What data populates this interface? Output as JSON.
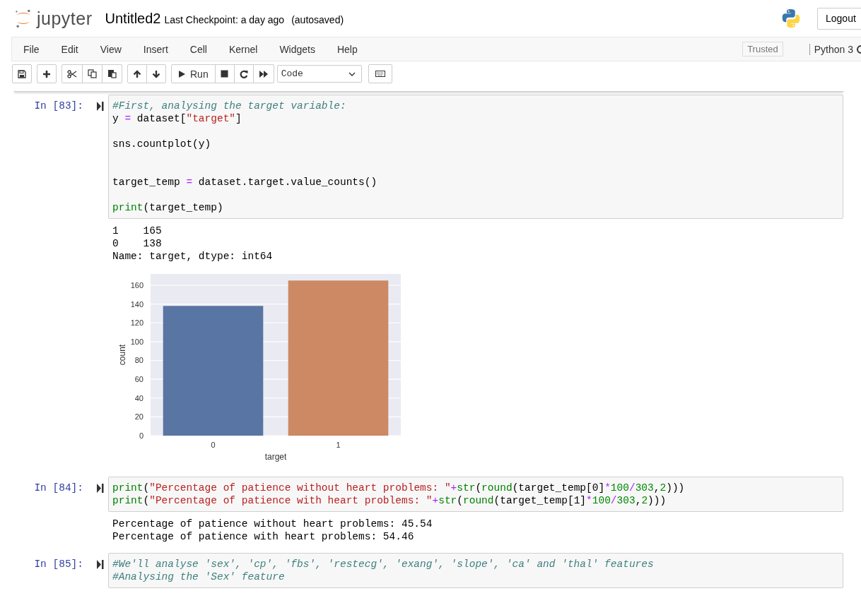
{
  "header": {
    "logo_text": "jupyter",
    "notebook_name": "Untitled2",
    "checkpoint": "Last Checkpoint: a day ago",
    "autosave": "(autosaved)",
    "logout": "Logout"
  },
  "menu": [
    "File",
    "Edit",
    "View",
    "Insert",
    "Cell",
    "Kernel",
    "Widgets",
    "Help"
  ],
  "trusted": "Trusted",
  "kernel_name": "Python 3",
  "toolbar": {
    "run_label": "Run",
    "cell_type": "Code"
  },
  "cells": [
    {
      "prompt": "In [83]:",
      "lines": [
        {
          "kind": "code",
          "tokens": [
            {
              "kind": "comment",
              "text": "#First, analysing the target variable:"
            }
          ]
        },
        {
          "kind": "code",
          "tokens": [
            {
              "kind": "plain",
              "text": "y "
            },
            {
              "kind": "operator",
              "text": "="
            },
            {
              "kind": "plain",
              "text": " dataset["
            },
            {
              "kind": "string",
              "text": "\"target\""
            },
            {
              "kind": "plain",
              "text": "]"
            }
          ]
        },
        {
          "kind": "blank"
        },
        {
          "kind": "code",
          "tokens": [
            {
              "kind": "plain",
              "text": "sns.countplot(y)"
            }
          ]
        },
        {
          "kind": "blank"
        },
        {
          "kind": "blank"
        },
        {
          "kind": "code",
          "tokens": [
            {
              "kind": "plain",
              "text": "target_temp "
            },
            {
              "kind": "operator",
              "text": "="
            },
            {
              "kind": "plain",
              "text": " dataset.target.value_counts()"
            }
          ]
        },
        {
          "kind": "blank"
        },
        {
          "kind": "code",
          "tokens": [
            {
              "kind": "builtin",
              "text": "print"
            },
            {
              "kind": "plain",
              "text": "(target_temp)"
            }
          ]
        }
      ],
      "output_text": [
        "1    165",
        "0    138",
        "Name: target, dtype: int64"
      ],
      "chart_data": {
        "type": "bar",
        "xlabel": "target",
        "ylabel": "count",
        "categories": [
          "0",
          "1"
        ],
        "values": [
          138,
          165
        ],
        "colors": [
          "#5975a4",
          "#cc8963"
        ],
        "grid": true,
        "ylim": [
          0,
          172
        ],
        "yticks": [
          0,
          20,
          40,
          60,
          80,
          100,
          120,
          140,
          160
        ]
      }
    },
    {
      "prompt": "In [84]:",
      "lines": [
        {
          "kind": "code",
          "tokens": [
            {
              "kind": "builtin",
              "text": "print"
            },
            {
              "kind": "plain",
              "text": "("
            },
            {
              "kind": "string",
              "text": "\"Percentage of patience without heart problems: \""
            },
            {
              "kind": "operator",
              "text": "+"
            },
            {
              "kind": "builtin",
              "text": "str"
            },
            {
              "kind": "plain",
              "text": "("
            },
            {
              "kind": "builtin",
              "text": "round"
            },
            {
              "kind": "plain",
              "text": "(target_temp[0]"
            },
            {
              "kind": "operator",
              "text": "*"
            },
            {
              "kind": "number",
              "text": "100"
            },
            {
              "kind": "operator",
              "text": "/"
            },
            {
              "kind": "number",
              "text": "303"
            },
            {
              "kind": "plain",
              "text": ","
            },
            {
              "kind": "number",
              "text": "2"
            },
            {
              "kind": "plain",
              "text": ")))"
            }
          ]
        },
        {
          "kind": "code",
          "tokens": [
            {
              "kind": "builtin",
              "text": "print"
            },
            {
              "kind": "plain",
              "text": "("
            },
            {
              "kind": "string",
              "text": "\"Percentage of patience with heart problems: \""
            },
            {
              "kind": "operator",
              "text": "+"
            },
            {
              "kind": "builtin",
              "text": "str"
            },
            {
              "kind": "plain",
              "text": "("
            },
            {
              "kind": "builtin",
              "text": "round"
            },
            {
              "kind": "plain",
              "text": "(target_temp[1]"
            },
            {
              "kind": "operator",
              "text": "*"
            },
            {
              "kind": "number",
              "text": "100"
            },
            {
              "kind": "operator",
              "text": "/"
            },
            {
              "kind": "number",
              "text": "303"
            },
            {
              "kind": "plain",
              "text": ","
            },
            {
              "kind": "number",
              "text": "2"
            },
            {
              "kind": "plain",
              "text": ")))"
            }
          ]
        }
      ],
      "output_text": [
        "Percentage of patience without heart problems: 45.54",
        "Percentage of patience with heart problems: 54.46"
      ]
    },
    {
      "prompt": "In [85]:",
      "lines": [
        {
          "kind": "code",
          "tokens": [
            {
              "kind": "comment",
              "text": "#We'll analyse 'sex', 'cp', 'fbs', 'restecg', 'exang', 'slope', 'ca' and 'thal' features"
            }
          ]
        },
        {
          "kind": "code",
          "tokens": [
            {
              "kind": "comment",
              "text": "#Analysing the 'Sex' feature"
            }
          ]
        }
      ]
    }
  ]
}
